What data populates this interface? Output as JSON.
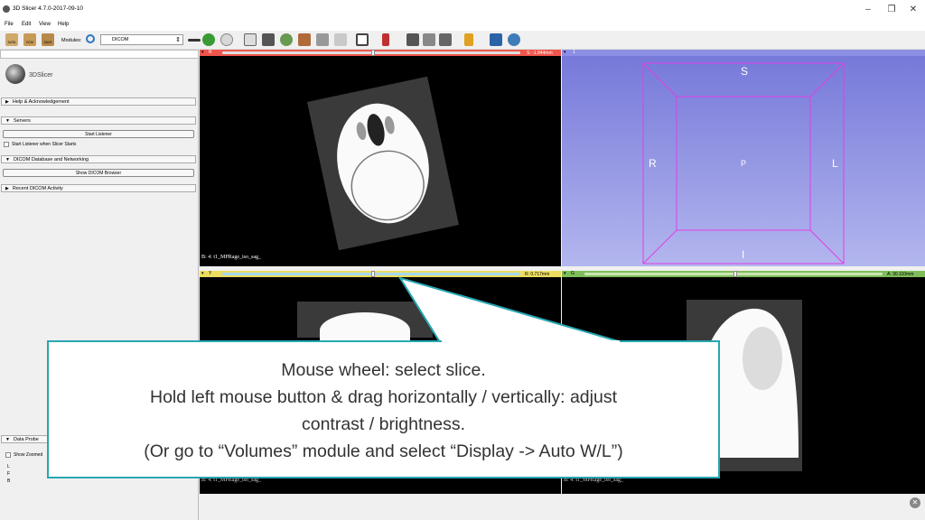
{
  "window": {
    "title": "3D Slicer 4.7.0-2017-09-10",
    "minimize": "–",
    "restore": "❐",
    "close": "✕"
  },
  "menu": [
    "File",
    "Edit",
    "View",
    "Help"
  ],
  "toolbar": {
    "data_btn": "DATA",
    "dcm_btn": "DCM",
    "save_btn": "SAVE",
    "modules_label": "Modules:",
    "module_value": "DICOM"
  },
  "panel": {
    "logo_text": "3DSlicer",
    "sections": {
      "help": "Help & Acknowledgement",
      "servers": "Servers",
      "dicom_db": "DICOM Database and Networking",
      "recent": "Recent DICOM Activity",
      "data_probe": "Data Probe"
    },
    "buttons": {
      "start_listener": "Start Listener",
      "show_browser": "Show DICOM Browser"
    },
    "checks": {
      "start_when": "Start Listener when Slicer Starts",
      "show_zoomed": "Show Zoomed"
    },
    "probe_rows": [
      "L",
      "F",
      "B"
    ]
  },
  "views": {
    "red": {
      "tag": "R",
      "offset": "S: -1.844mm",
      "label": "B: 4: t1_MPRage_iso_sag_",
      "color": "#f0554c"
    },
    "yellow": {
      "tag": "Y",
      "offset": "R: 0.717mm",
      "label": "B: 4: t1_MPRage_iso_sag_",
      "color": "#eddd5e"
    },
    "green": {
      "tag": "G",
      "offset": "A: 30.110mm",
      "label": "B: 4: t1_MPRage_iso_sag_",
      "color": "#7ebd59"
    },
    "threeD": {
      "tag": "1",
      "S": "S",
      "I": "I",
      "R": "R",
      "L": "L",
      "P": "P",
      "color": "#8d8fe5"
    }
  },
  "callout": [
    "Mouse wheel: select slice.",
    "Hold left mouse button & drag horizontally / vertically: adjust",
    "contrast / brightness.",
    "(Or go to “Volumes” module and select “Display -> Auto W/L”)"
  ],
  "status": {
    "icon": "close-circle-icon"
  }
}
